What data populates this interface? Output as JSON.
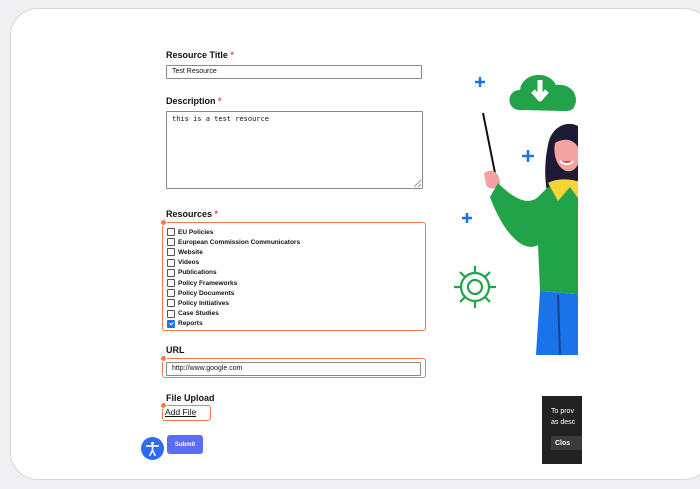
{
  "form": {
    "title_label": "Resource Title",
    "required_mark": "*",
    "title_value": "Test Resource",
    "description_label": "Description",
    "description_value": "this is a test resource",
    "resources_label": "Resources",
    "resources": [
      {
        "label": "EU Policies",
        "checked": false
      },
      {
        "label": "European Commission Communicators",
        "checked": false
      },
      {
        "label": "Website",
        "checked": false
      },
      {
        "label": "Videos",
        "checked": false
      },
      {
        "label": "Publications",
        "checked": false
      },
      {
        "label": "Policy Frameworks",
        "checked": false
      },
      {
        "label": "Policy Documents",
        "checked": false
      },
      {
        "label": "Policy Initiatives",
        "checked": false
      },
      {
        "label": "Case Studies",
        "checked": false
      },
      {
        "label": "Reports",
        "checked": true
      }
    ],
    "url_label": "URL",
    "url_value": "http://www.google.com",
    "file_upload_label": "File Upload",
    "add_file_label": "Add File",
    "submit_label": "Submit"
  },
  "cookie_banner": {
    "line1": "To prov",
    "line2": "as desc",
    "button_label": "Clos"
  },
  "illustration": {
    "icons": [
      "cloud-download-icon",
      "gear-icon",
      "plus-icon",
      "teacher-pointer-illustration"
    ]
  },
  "colors": {
    "accent": "#5b6cf5",
    "highlight": "#f07b4c",
    "required": "#e5484d",
    "green": "#22a34a",
    "blue": "#1a73e8",
    "accessibility": "#2f6bf0"
  }
}
